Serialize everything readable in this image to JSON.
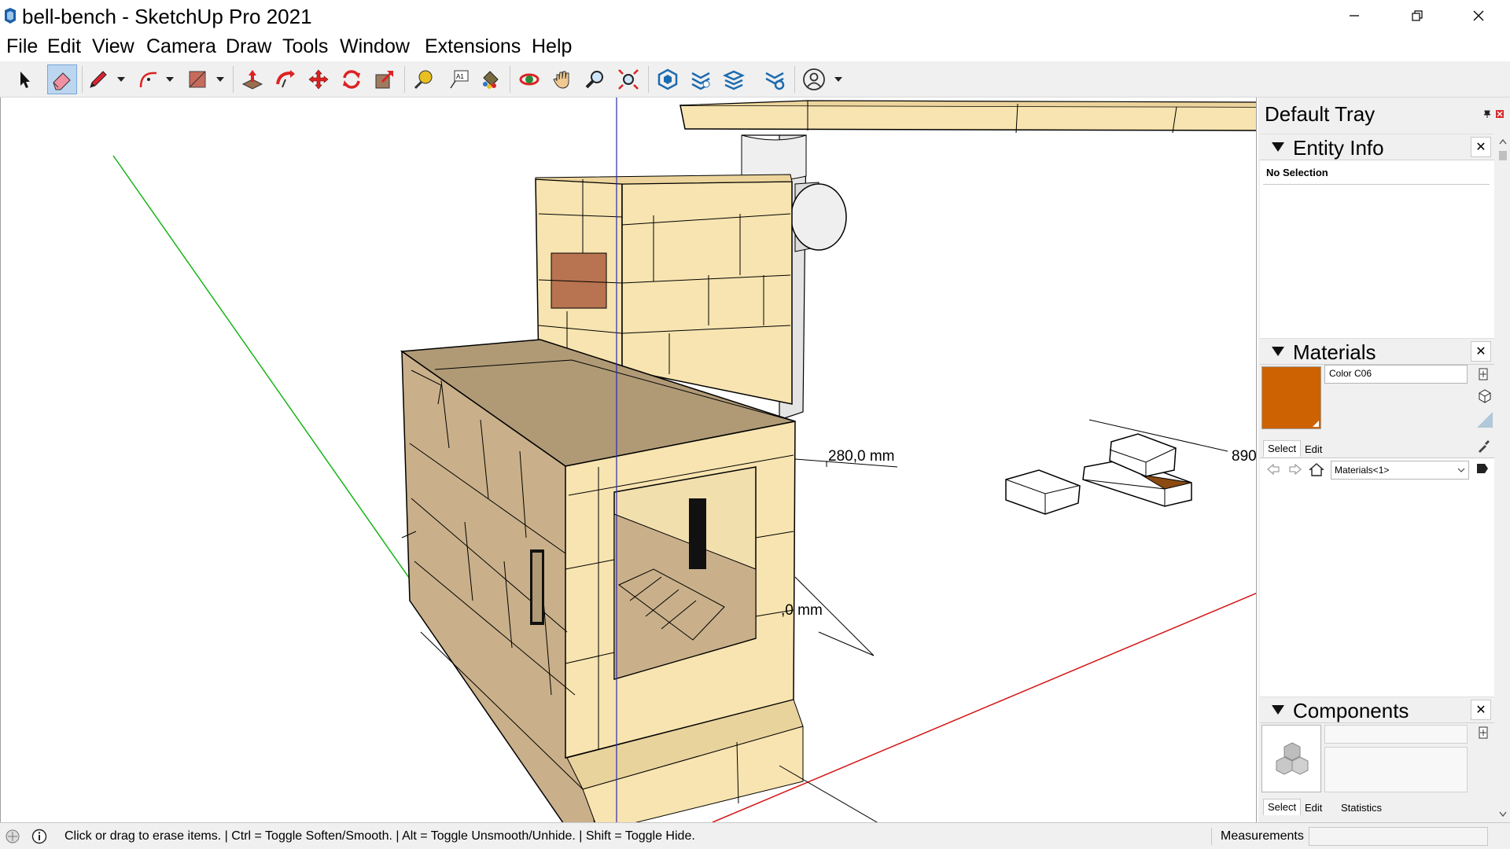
{
  "window": {
    "title": "bell-bench - SketchUp Pro 2021",
    "minimize_icon": "minimize-icon",
    "maximize_icon": "restore-icon",
    "close_icon": "close-icon"
  },
  "menu": [
    "File",
    "Edit",
    "View",
    "Camera",
    "Draw",
    "Tools",
    "Window",
    "Extensions",
    "Help"
  ],
  "toolbar": {
    "tools": [
      "select-icon",
      "eraser-icon",
      "pencil-icon",
      "arc-icon",
      "rectangle-icon",
      "push-pull-icon",
      "follow-me-icon",
      "move-icon",
      "rotate-icon",
      "scale-icon",
      "tape-measure-icon",
      "text-icon",
      "paint-bucket-icon",
      "orbit-icon",
      "pan-icon",
      "zoom-icon",
      "zoom-extents-icon",
      "warehouse-icon",
      "extension-warehouse-icon",
      "layout-icon",
      "extension-manager-icon",
      "profile-icon"
    ],
    "active_tool": "eraser-icon"
  },
  "viewport": {
    "dimensions": [
      "280,0 mm",
      ",0 mm",
      "890"
    ],
    "colors": {
      "green_axis": "#18b418",
      "red_axis": "#d41414",
      "blue_axis": "#2a2ab4",
      "brick": "#f8e4b0",
      "brick_dark": "#b09a76",
      "special_brick": "#b87350"
    }
  },
  "tray": {
    "title": "Default Tray",
    "entity_info": {
      "title": "Entity Info",
      "selection": "No Selection",
      "close": "✕"
    },
    "materials": {
      "title": "Materials",
      "close": "✕",
      "material_name": "Color C06",
      "swatch_color": "#cc6202",
      "tabs": [
        "Select",
        "Edit"
      ],
      "library": "Materials<1>"
    },
    "components": {
      "title": "Components",
      "close": "✕",
      "tabs": [
        "Select",
        "Edit",
        "Statistics"
      ]
    }
  },
  "status": {
    "hint": "Click or drag to erase items. | Ctrl = Toggle Soften/Smooth. | Alt = Toggle Unsmooth/Unhide. | Shift = Toggle Hide.",
    "measurements_label": "Measurements",
    "measurements_value": ""
  }
}
